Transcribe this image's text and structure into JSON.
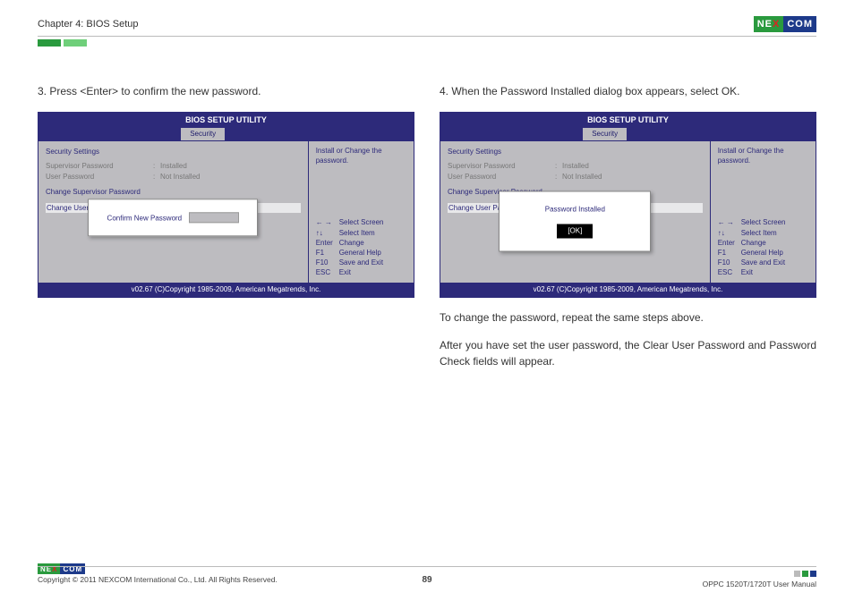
{
  "header": {
    "chapter": "Chapter 4: BIOS Setup",
    "logo_left": "NE",
    "logo_x": "X",
    "logo_right": "COM"
  },
  "left": {
    "step": "3.  Press <Enter> to confirm the new password."
  },
  "right": {
    "step": "4.  When the Password Installed dialog box appears, select OK.",
    "after1": "To change the password, repeat the same steps above.",
    "after2": "After you have set the user password, the Clear User Password and Password Check fields will appear."
  },
  "bios": {
    "title": "BIOS SETUP UTILITY",
    "tab": "Security",
    "section_heading": "Security Settings",
    "rows": [
      {
        "label": "Supervisor Password",
        "colon": ":",
        "value": "Installed"
      },
      {
        "label": "User Password",
        "colon": ":",
        "value": "Not Installed"
      }
    ],
    "menu1": "Change Supervisor Password",
    "menu2": "Change User Password",
    "side_hint": "Install or Change the password.",
    "nav": {
      "k1": "←  →",
      "v1": "Select Screen",
      "k2": "↑↓",
      "v2": "Select Item",
      "k3": "Enter",
      "v3": "Change",
      "k4": "F1",
      "v4": "General Help",
      "k5": "F10",
      "v5": "Save and Exit",
      "k6": "ESC",
      "v6": "Exit"
    },
    "footer": "v02.67 (C)Copyright 1985-2009, American Megatrends, Inc.",
    "popup_left": {
      "label": "Confirm New Password"
    },
    "popup_right": {
      "title": "Password Installed",
      "ok": "[OK]"
    }
  },
  "footer": {
    "copyright": "Copyright © 2011 NEXCOM International Co., Ltd. All Rights Reserved.",
    "page": "89",
    "manual": "OPPC 1520T/1720T User Manual"
  }
}
